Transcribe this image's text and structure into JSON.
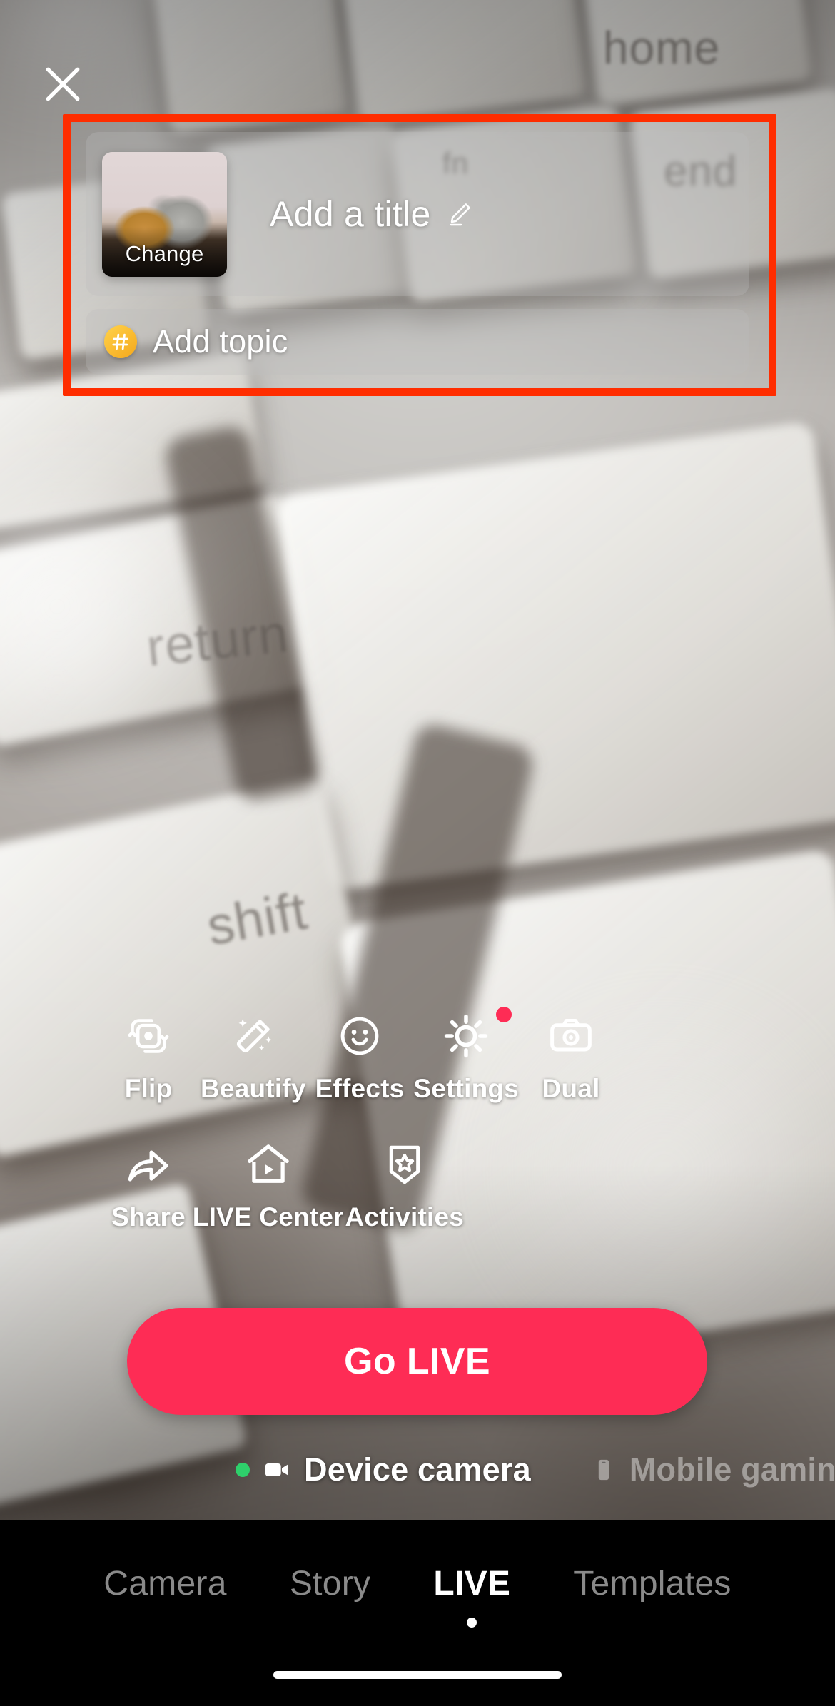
{
  "screen": {
    "app": "TikTok LIVE setup",
    "accent_color": "#FE2C55",
    "annotation_color": "#FF2D00",
    "badge_color": "#FE2C55",
    "active_dot_color": "#2ED06B",
    "hashtag_badge_color": "#F5A81C"
  },
  "header": {
    "close_icon": "close-icon"
  },
  "info_panel": {
    "title_placeholder": "Add a title",
    "title_edit_icon": "pencil-icon",
    "thumbnail_change_label": "Change",
    "thumbnail_alt": "two cats video thumbnail",
    "topic_label": "Add topic",
    "topic_icon": "hashtag-icon"
  },
  "tools_row_1": [
    {
      "label": "Flip",
      "icon": "flip-camera-icon",
      "badge": false
    },
    {
      "label": "Beautify",
      "icon": "magic-wand-icon",
      "badge": false
    },
    {
      "label": "Effects",
      "icon": "smiley-face-icon",
      "badge": false
    },
    {
      "label": "Settings",
      "icon": "gear-icon",
      "badge": true
    },
    {
      "label": "Dual",
      "icon": "camera-icon",
      "badge": false
    }
  ],
  "tools_row_2": [
    {
      "label": "Share",
      "icon": "share-arrow-icon"
    },
    {
      "label": "LIVE Center",
      "icon": "house-play-icon"
    },
    {
      "label": "Activities",
      "icon": "badge-star-icon"
    }
  ],
  "primary_action": {
    "label": "Go LIVE"
  },
  "mode_selector": [
    {
      "label": "Device camera",
      "icon": "video-camera-icon",
      "active": true
    },
    {
      "label": "Mobile gaming",
      "icon": "phone-icon",
      "active": false
    }
  ],
  "bottom_tabs": [
    {
      "label": "Camera",
      "active": false
    },
    {
      "label": "Story",
      "active": false
    },
    {
      "label": "LIVE",
      "active": true
    },
    {
      "label": "Templates",
      "active": false
    }
  ]
}
